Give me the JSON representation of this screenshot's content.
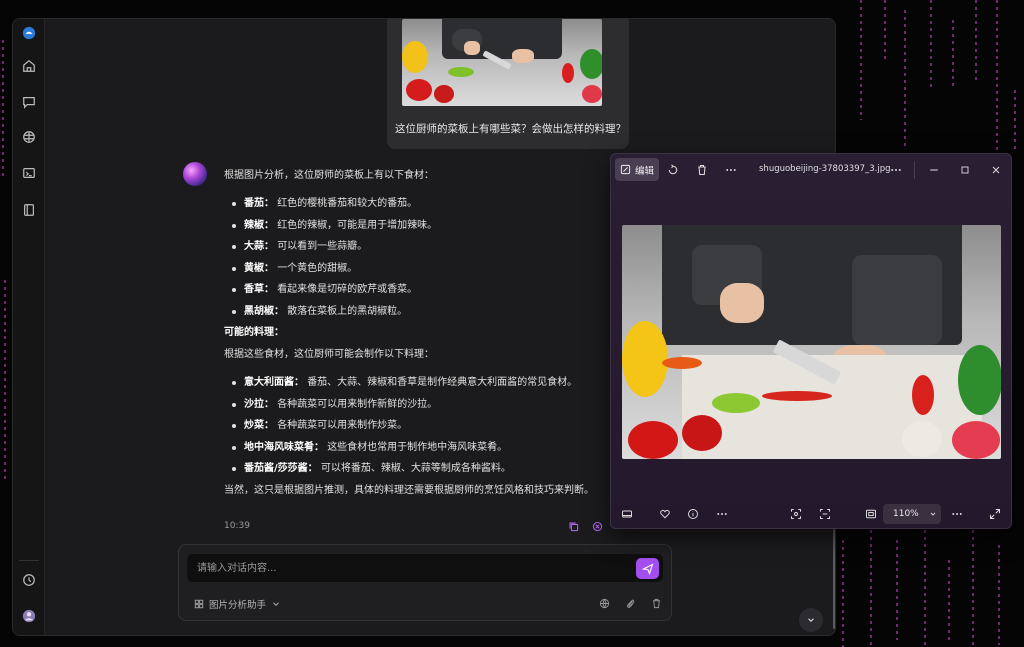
{
  "chat": {
    "user_question": "这位厨师的菜板上有哪些菜？会做出怎样的料理？",
    "answer_intro": "根据图片分析，这位厨师的菜板上有以下食材：",
    "ingredients": [
      {
        "name": "番茄：",
        "desc": "红色的樱桃番茄和较大的番茄。"
      },
      {
        "name": "辣椒：",
        "desc": "红色的辣椒，可能是用于增加辣味。"
      },
      {
        "name": "大蒜：",
        "desc": "可以看到一些蒜瓣。"
      },
      {
        "name": "黄椒：",
        "desc": "一个黄色的甜椒。"
      },
      {
        "name": "香草：",
        "desc": "看起来像是切碎的欧芹或香菜。"
      },
      {
        "name": "黑胡椒：",
        "desc": "散落在菜板上的黑胡椒粒。"
      }
    ],
    "dishes_heading": "可能的料理：",
    "dishes_intro": "根据这些食材，这位厨师可能会制作以下料理：",
    "dishes": [
      {
        "name": "意大利面酱：",
        "desc": "番茄、大蒜、辣椒和香草是制作经典意大利面酱的常见食材。"
      },
      {
        "name": "沙拉：",
        "desc": "各种蔬菜可以用来制作新鲜的沙拉。"
      },
      {
        "name": "炒菜：",
        "desc": "各种蔬菜可以用来制作炒菜。"
      },
      {
        "name": "地中海风味菜肴：",
        "desc": "这些食材也常用于制作地中海风味菜肴。"
      },
      {
        "name": "番茄酱/莎莎酱：",
        "desc": "可以将番茄、辣椒、大蒜等制成各种酱料。"
      }
    ],
    "conclusion": "当然，这只是根据图片推测，具体的料理还需要根据厨师的烹饪风格和技巧来判断。",
    "timestamp": "10:39"
  },
  "input": {
    "placeholder": "请输入对话内容...",
    "assistant_label": "图片分析助手"
  },
  "viewer": {
    "edit_label": "编辑",
    "file_name": "shuguobeijing-37803397_3.jpg",
    "zoom": "110%"
  },
  "icons": {
    "sidebar": [
      "app-logo-icon",
      "home-icon",
      "chat-icon",
      "brain-icon",
      "terminal-icon",
      "book-icon",
      "history-icon",
      "user-avatar"
    ],
    "viewer_top": [
      "edit-icon",
      "rotate-icon",
      "delete-icon",
      "more-icon",
      "minimize-icon",
      "maximize-icon",
      "close-icon"
    ],
    "viewer_bottom": [
      "filmstrip-icon",
      "favorite-icon",
      "info-icon",
      "more-icon",
      "crop-icon",
      "scan-icon",
      "fit-icon",
      "fullscreen-icon"
    ]
  },
  "colors": {
    "accent": "#a44ef0",
    "viewer_bg": "#2a1e33"
  }
}
